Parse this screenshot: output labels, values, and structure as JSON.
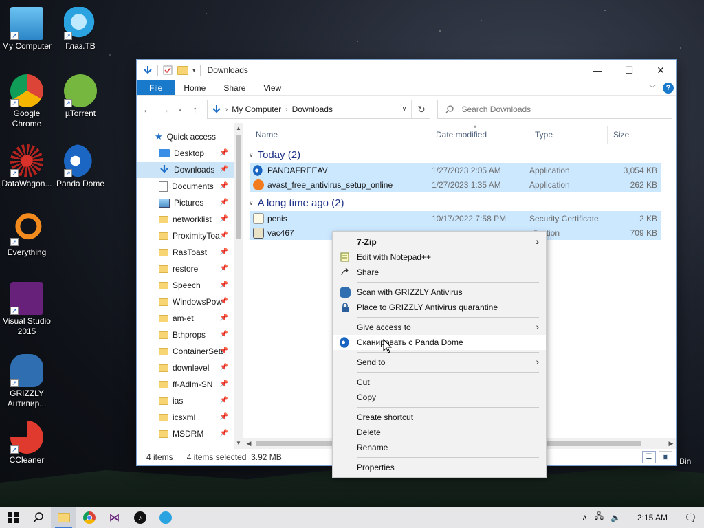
{
  "desktop": {
    "icons": [
      {
        "label": "My Computer",
        "icon": "computer-icon"
      },
      {
        "label": "Глаз.ТВ",
        "icon": "glaz-tv-icon"
      },
      {
        "label": "Google Chrome",
        "icon": "chrome-icon"
      },
      {
        "label": "µTorrent",
        "icon": "utorrent-icon"
      },
      {
        "label": "DataWagon...",
        "icon": "datawagon-icon"
      },
      {
        "label": "Panda Dome",
        "icon": "panda-dome-icon"
      },
      {
        "label": "Everything",
        "icon": "everything-search-icon"
      },
      {
        "label": "Visual Studio 2015",
        "icon": "visual-studio-icon"
      },
      {
        "label": "GRIZZLY Антивир...",
        "icon": "grizzly-antivirus-icon"
      },
      {
        "label": "CCleaner",
        "icon": "ccleaner-icon"
      }
    ],
    "recycle_label": "Bin"
  },
  "window": {
    "title": "Downloads",
    "controls": {
      "minimize": "—",
      "maximize": "☐",
      "close": "✕"
    },
    "ribbon_tabs": [
      "File",
      "Home",
      "Share",
      "View"
    ],
    "breadcrumb": [
      "My Computer",
      "Downloads"
    ],
    "search_placeholder": "Search Downloads",
    "columns": {
      "name": "Name",
      "date": "Date modified",
      "type": "Type",
      "size": "Size"
    },
    "groups": [
      {
        "label": "Today (2)",
        "files": [
          {
            "name": "PANDAFREEAV",
            "date": "1/27/2023 2:05 AM",
            "type": "Application",
            "size": "3,054 KB",
            "icon": "panda-installer-icon"
          },
          {
            "name": "avast_free_antivirus_setup_online",
            "date": "1/27/2023 1:35 AM",
            "type": "Application",
            "size": "262 KB",
            "icon": "avast-installer-icon"
          }
        ]
      },
      {
        "label": "A long time ago (2)",
        "files": [
          {
            "name": "penis",
            "date": "10/17/2022 7:58 PM",
            "type": "Security Certificate",
            "size": "2 KB",
            "icon": "certificate-icon"
          },
          {
            "name": "vac467",
            "date": "",
            "type": "plication",
            "size": "709 KB",
            "icon": "application-icon"
          }
        ]
      }
    ],
    "nav": {
      "quick_access": "Quick access",
      "items": [
        {
          "label": "Desktop",
          "icon": "desktop-folder-icon",
          "pinned": true
        },
        {
          "label": "Downloads",
          "icon": "downloads-folder-icon",
          "pinned": true,
          "selected": true
        },
        {
          "label": "Documents",
          "icon": "documents-folder-icon",
          "pinned": true
        },
        {
          "label": "Pictures",
          "icon": "pictures-folder-icon",
          "pinned": true
        },
        {
          "label": "networklist",
          "icon": "folder-icon",
          "pinned": true
        },
        {
          "label": "ProximityToa",
          "icon": "folder-icon",
          "pinned": true
        },
        {
          "label": "RasToast",
          "icon": "folder-icon",
          "pinned": true
        },
        {
          "label": "restore",
          "icon": "folder-icon",
          "pinned": true
        },
        {
          "label": "Speech",
          "icon": "folder-icon",
          "pinned": true
        },
        {
          "label": "WindowsPow",
          "icon": "folder-icon",
          "pinned": true
        },
        {
          "label": "am-et",
          "icon": "folder-icon",
          "pinned": true
        },
        {
          "label": "Bthprops",
          "icon": "folder-icon",
          "pinned": true
        },
        {
          "label": "ContainerSett",
          "icon": "folder-icon",
          "pinned": true
        },
        {
          "label": "downlevel",
          "icon": "folder-icon",
          "pinned": true
        },
        {
          "label": "ff-Adlm-SN",
          "icon": "folder-icon",
          "pinned": true
        },
        {
          "label": "ias",
          "icon": "folder-icon",
          "pinned": true
        },
        {
          "label": "icsxml",
          "icon": "folder-icon",
          "pinned": true
        },
        {
          "label": "MSDRM",
          "icon": "folder-icon",
          "pinned": true
        }
      ]
    },
    "status": {
      "items": "4 items",
      "selected": "4 items selected",
      "size": "3.92 MB"
    }
  },
  "context_menu": {
    "items": [
      {
        "label": "7-Zip",
        "submenu": true,
        "bold": true,
        "icon": ""
      },
      {
        "label": "Edit with Notepad++",
        "icon": "notepad-plus-plus-icon"
      },
      {
        "label": "Share",
        "icon": "share-icon"
      },
      {
        "sep": true
      },
      {
        "label": "Scan with GRIZZLY Antivirus",
        "icon": "grizzly-scan-icon"
      },
      {
        "label": "Place to GRIZZLY Antivirus quarantine",
        "icon": "quarantine-lock-icon"
      },
      {
        "sep": true
      },
      {
        "label": "Give access to",
        "submenu": true,
        "icon": ""
      },
      {
        "label": "Сканировать с Panda Dome",
        "icon": "panda-dome-icon",
        "hover": true
      },
      {
        "sep": true
      },
      {
        "label": "Send to",
        "submenu": true,
        "icon": ""
      },
      {
        "sep": true
      },
      {
        "label": "Cut",
        "icon": ""
      },
      {
        "label": "Copy",
        "icon": ""
      },
      {
        "sep": true
      },
      {
        "label": "Create shortcut",
        "icon": ""
      },
      {
        "label": "Delete",
        "icon": ""
      },
      {
        "label": "Rename",
        "icon": ""
      },
      {
        "sep": true
      },
      {
        "label": "Properties",
        "icon": ""
      }
    ]
  },
  "taskbar": {
    "apps": [
      {
        "name": "start-button",
        "icon": "windows-logo-icon"
      },
      {
        "name": "search-button",
        "icon": "search-icon"
      },
      {
        "name": "file-explorer",
        "icon": "file-explorer-icon",
        "active": true
      },
      {
        "name": "chrome",
        "icon": "chrome-icon"
      },
      {
        "name": "visual-studio",
        "icon": "visual-studio-icon"
      },
      {
        "name": "tiktok",
        "icon": "tiktok-icon"
      },
      {
        "name": "glaz-tv",
        "icon": "glaz-tv-icon"
      }
    ],
    "time": "2:15 AM"
  }
}
